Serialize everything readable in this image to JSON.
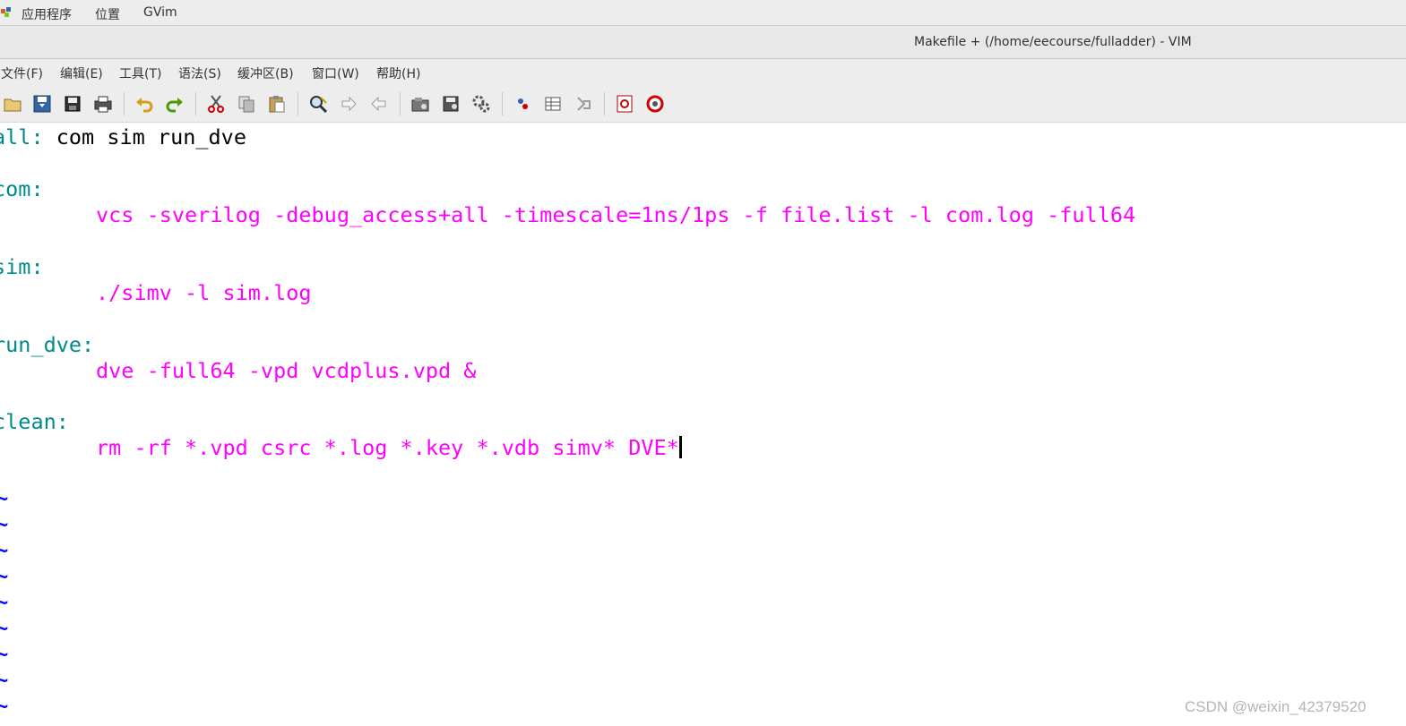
{
  "panel": {
    "applications": "应用程序",
    "places": "位置",
    "app_name": "GVim"
  },
  "window": {
    "title": "Makefile + (/home/eecourse/fulladder) - VIM"
  },
  "menu": {
    "file": "文件(F)",
    "edit": "编辑(E)",
    "tools": "工具(T)",
    "syntax": "语法(S)",
    "buffers": "缓冲区(B)",
    "window": "窗口(W)",
    "help": "帮助(H)"
  },
  "toolbar_icons": [
    "open-icon",
    "save-icon",
    "save-all-icon",
    "print-icon",
    "undo-icon",
    "redo-icon",
    "cut-icon",
    "copy-icon",
    "paste-icon",
    "find-replace-icon",
    "find-next-icon",
    "find-previous-icon",
    "load-session-icon",
    "save-session-icon",
    "run-script-icon",
    "make-icon",
    "run-ctags-icon",
    "jump-to-tag-icon",
    "help-icon",
    "find-help-icon"
  ],
  "colors": {
    "target_label": "#008b8b",
    "command": "#ff00ff",
    "tilde": "#0000ff",
    "plain": "#000000"
  },
  "editor": {
    "line1_label": "all:",
    "line1_rest": " com sim run_dve",
    "com_label": "com:",
    "com_cmd": "vcs -sverilog -debug_access+all -timescale=1ns/1ps -f file.list -l com.log -full64",
    "sim_label": "sim:",
    "sim_cmd": "./simv -l sim.log",
    "run_dve_label": "run_dve:",
    "run_dve_cmd": "dve -full64 -vpd vcdplus.vpd &",
    "clean_label": "clean:",
    "clean_cmd": "rm -rf *.vpd csrc *.log *.key *.vdb simv* DVE*",
    "tilde": "~"
  },
  "watermark": "CSDN @weixin_42379520"
}
